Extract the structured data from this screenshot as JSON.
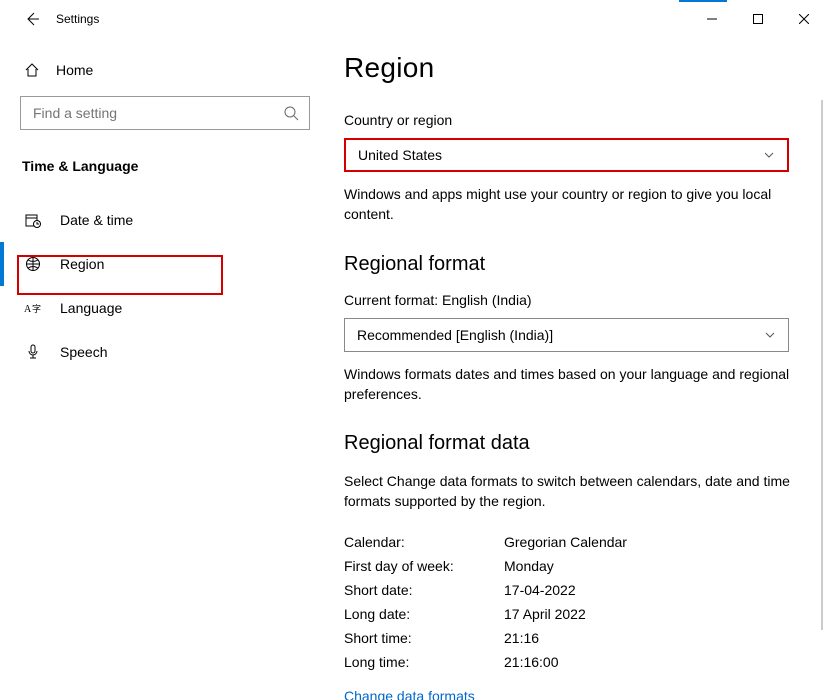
{
  "titlebar": {
    "title": "Settings"
  },
  "sidebar": {
    "home": "Home",
    "search_placeholder": "Find a setting",
    "category": "Time & Language",
    "items": [
      {
        "label": "Date & time"
      },
      {
        "label": "Region"
      },
      {
        "label": "Language"
      },
      {
        "label": "Speech"
      }
    ]
  },
  "page": {
    "title": "Region",
    "country_label": "Country or region",
    "country_value": "United States",
    "country_desc": "Windows and apps might use your country or region to give you local content.",
    "format_title": "Regional format",
    "format_current_prefix": "Current format: ",
    "format_current_value": "English (India)",
    "format_dropdown": "Recommended [English (India)]",
    "format_desc": "Windows formats dates and times based on your language and regional preferences.",
    "data_title": "Regional format data",
    "data_desc": "Select Change data formats to switch between calendars, date and time formats supported by the region.",
    "rows": [
      {
        "k": "Calendar:",
        "v": "Gregorian Calendar"
      },
      {
        "k": "First day of week:",
        "v": "Monday"
      },
      {
        "k": "Short date:",
        "v": "17-04-2022"
      },
      {
        "k": "Long date:",
        "v": "17 April 2022"
      },
      {
        "k": "Short time:",
        "v": "21:16"
      },
      {
        "k": "Long time:",
        "v": "21:16:00"
      }
    ],
    "change_link": "Change data formats"
  }
}
